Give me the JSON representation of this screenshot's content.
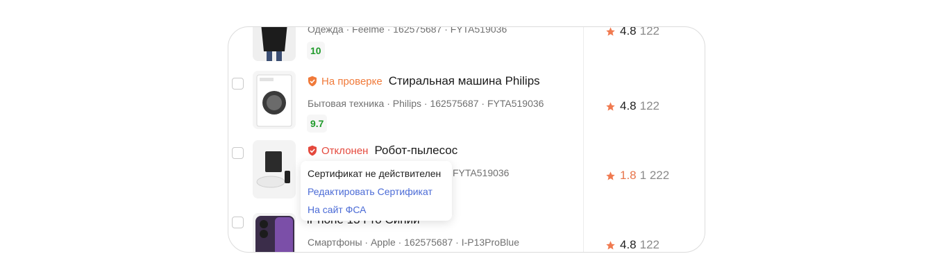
{
  "products": [
    {
      "status": "",
      "title": "",
      "meta": "Одежда · Feelme · 162575687 · FYTA519036",
      "score": "10",
      "rating": "4.8",
      "reviews": "122"
    },
    {
      "status": "На проверке",
      "title": "Стиральная машина Philips",
      "meta": "Бытовая техника · Philips · 162575687 · FYTA519036",
      "score": "9.7",
      "rating": "4.8",
      "reviews": "122"
    },
    {
      "status": "Отклонен",
      "title": "Робот-пылесос",
      "meta": "FYTA519036",
      "score": "",
      "rating": "1.8",
      "reviews": "1 222"
    },
    {
      "status": "",
      "title": "iPhone 13 Pro Синий",
      "meta": "Смартфоны · Apple · 162575687 · I-P13ProBlue",
      "score": "",
      "rating": "4.8",
      "reviews": "122"
    }
  ],
  "tooltip": {
    "message": "Сертификат не действителен",
    "edit_link": "Редактировать Сертификат",
    "fsa_link": "На сайт ФСА"
  },
  "colors": {
    "pending": "#f07a3a",
    "rejected": "#e4493d",
    "score": "#1f9a2a",
    "star": "#f07a50",
    "link": "#4b6bd6"
  }
}
